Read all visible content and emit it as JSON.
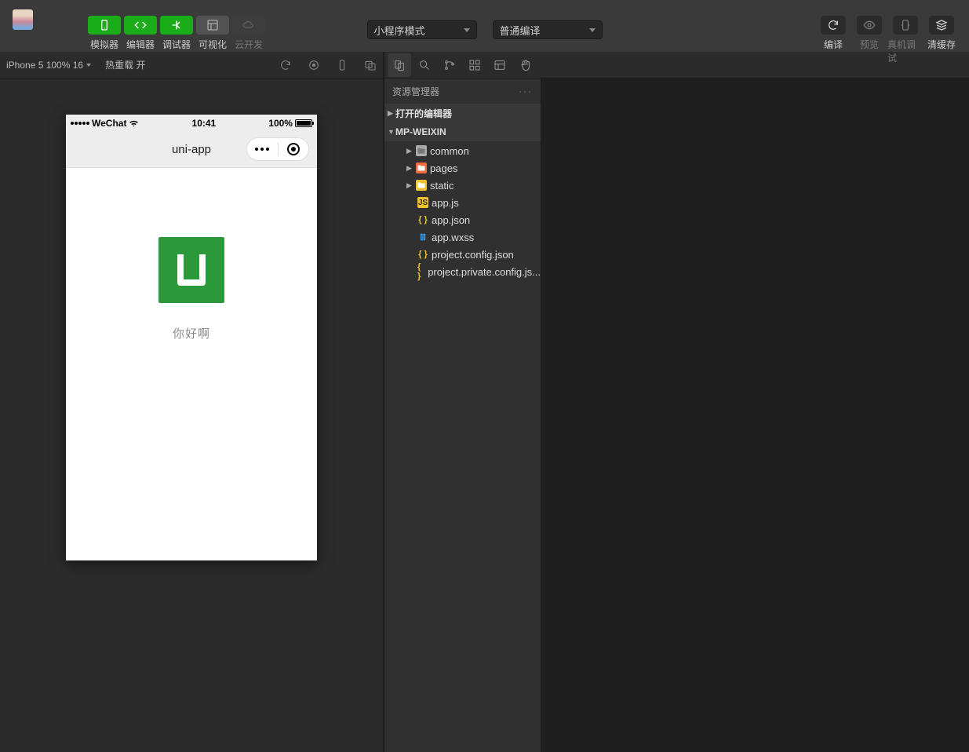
{
  "topbar": {
    "modes": [
      {
        "label": "模拟器",
        "icon": "phone",
        "active": true
      },
      {
        "label": "编辑器",
        "icon": "code",
        "active": true
      },
      {
        "label": "调试器",
        "icon": "branch",
        "active": true
      },
      {
        "label": "可视化",
        "icon": "layout",
        "grey": true
      },
      {
        "label": "云开发",
        "icon": "cloud",
        "disabled": true
      }
    ],
    "mode_select": "小程序模式",
    "compile_select": "普通编译",
    "right": [
      {
        "label": "编译",
        "icon": "refresh"
      },
      {
        "label": "预览",
        "icon": "eye",
        "dim": true
      },
      {
        "label": "真机调试",
        "icon": "bug",
        "dim": true
      },
      {
        "label": "清缓存",
        "icon": "stack"
      }
    ]
  },
  "simulator": {
    "device": "iPhone 5 100% 16",
    "hotreload": "热重载 开",
    "phone": {
      "carrier": "WeChat",
      "time": "10:41",
      "battery": "100%",
      "title": "uni-app",
      "hello": "你好啊"
    }
  },
  "explorer": {
    "header": "资源管理器",
    "sections": {
      "open_editors": "打开的编辑器",
      "project": "MP-WEIXIN"
    },
    "folders": [
      {
        "name": "common",
        "kind": "folder"
      },
      {
        "name": "pages",
        "kind": "pages"
      },
      {
        "name": "static",
        "kind": "static"
      }
    ],
    "files": [
      {
        "name": "app.js",
        "kind": "js"
      },
      {
        "name": "app.json",
        "kind": "json"
      },
      {
        "name": "app.wxss",
        "kind": "wxss"
      },
      {
        "name": "project.config.json",
        "kind": "json"
      },
      {
        "name": "project.private.config.js...",
        "kind": "json"
      }
    ]
  }
}
